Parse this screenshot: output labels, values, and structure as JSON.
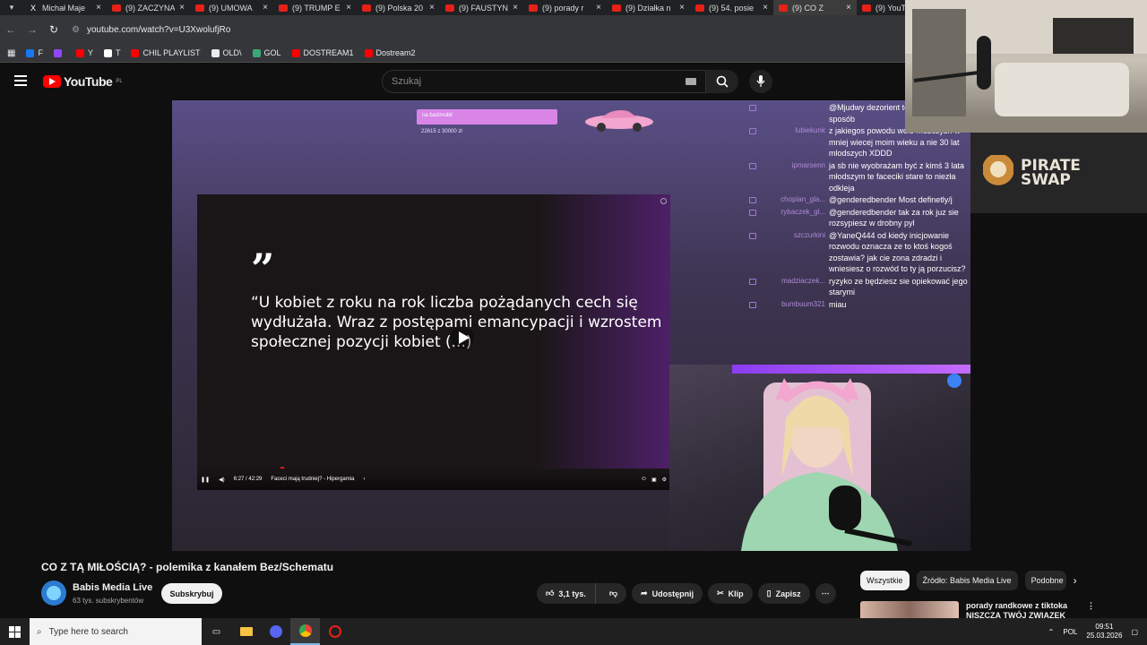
{
  "browser": {
    "tabs": [
      {
        "label": "Michał Maje",
        "icon": "x-icon"
      },
      {
        "label": "(9) ZACZYNA",
        "icon": "youtube-icon"
      },
      {
        "label": "(9) UMOWA",
        "icon": "youtube-icon"
      },
      {
        "label": "(9) TRUMP E",
        "icon": "youtube-icon"
      },
      {
        "label": "(9) Polska 20",
        "icon": "youtube-icon"
      },
      {
        "label": "(9) FAUSTYN",
        "icon": "youtube-icon"
      },
      {
        "label": "(9) porady r",
        "icon": "youtube-icon"
      },
      {
        "label": "(9) Działka n",
        "icon": "youtube-icon"
      },
      {
        "label": "(9) 54. posie",
        "icon": "youtube-icon"
      },
      {
        "label": "(9) CO Z",
        "icon": "youtube-icon"
      },
      {
        "label": "(9) YouTub",
        "icon": "youtube-icon"
      }
    ],
    "url": "youtube.com/watch?v=U3XwolufjRo",
    "bookmarks": [
      {
        "label": "F",
        "color": "#1877f2"
      },
      {
        "label": "",
        "color": "#9146ff"
      },
      {
        "label": "Y",
        "color": "#ff0000"
      },
      {
        "label": "T",
        "color": "#ffffff"
      },
      {
        "label": "CHIL PLAYLIST",
        "color": "#ff0000"
      },
      {
        "label": "OLD\\",
        "color": "#e8eaed"
      },
      {
        "label": "GOL",
        "color": "#3aa876"
      },
      {
        "label": "DOSTREAM1",
        "color": "#ff0000"
      },
      {
        "label": "Dostream2",
        "color": "#ff0000"
      }
    ]
  },
  "youtube": {
    "logo_text": "YouTube",
    "logo_region": "PL",
    "search_placeholder": "Szukaj"
  },
  "stream": {
    "goal_label": "na bazimobil",
    "goal_progress": "22615 z 30000 zł",
    "quote_mark": "”",
    "quote_text": "“U kobiet z roku na rok liczba pożądanych cech się wydłużała. Wraz z postępami emancypacji i wzrostem społecznej pozycji kobiet (...)",
    "inner_time": "6:27 / 42:29",
    "inner_title": "Faceci mają trudniej? - Hipergamia",
    "inner_progress": 0.18,
    "chat": [
      {
        "user": "",
        "text": "@Mjudwy dezorient tego. W jaki sposób"
      },
      {
        "user": "lubiekunk",
        "text": "z jakiegos powodu wole mezczyzn w mniej wiecej moim wieku a nie 30 lat mlodszych XDDD"
      },
      {
        "user": "ipmarsenn",
        "text": "ja sb nie wyobrażam być z kimś 3 lata młodszym te faceciki stare to niezła odkleja"
      },
      {
        "user": "chopian_gla...",
        "text": "@genderedbender Most definetly/j"
      },
      {
        "user": "rybaczek_gl...",
        "text": "@genderedbender tak za rok juz sie rozsypiesz w drobny pyl"
      },
      {
        "user": "szczurkini",
        "text": "@YaneQ444 od kiedy inicjowanie rozwodu oznacza ze to ktoś kogoś zostawia? jak cie zona zdradzi i wniesiesz o rozwód to ty ją porzucisz?"
      },
      {
        "user": "madziaczek...",
        "text": "ryzyko ze będziesz sie opiekować jego starymi"
      },
      {
        "user": "bumbuum321",
        "text": "miau"
      }
    ]
  },
  "ad": {
    "brand_line1": "PIRATE",
    "brand_line2": "SWAP"
  },
  "video": {
    "title": "CO Z TĄ MIŁOŚCIĄ? - polemika z kanałem Bez/Schematu",
    "channel": "Babis Media Live",
    "subscribers": "63 tys. subskrybentów",
    "subscribe_label": "Subskrybuj",
    "likes": "3,1 tys.",
    "share_label": "Udostępnij",
    "clip_label": "Klip",
    "save_label": "Zapisz"
  },
  "sidebar": {
    "chips": [
      "Wszystkie",
      "Źródło: Babis Media Live",
      "Podobne"
    ],
    "rec_title_line1": "porady randkowe z tiktoka",
    "rec_title_line2": "NISZCZĄ TWÓJ ZWIĄZEK"
  },
  "taskbar": {
    "search_placeholder": "Type here to search",
    "lang": "POL",
    "time": "09:51",
    "date": "25.03.2026"
  }
}
